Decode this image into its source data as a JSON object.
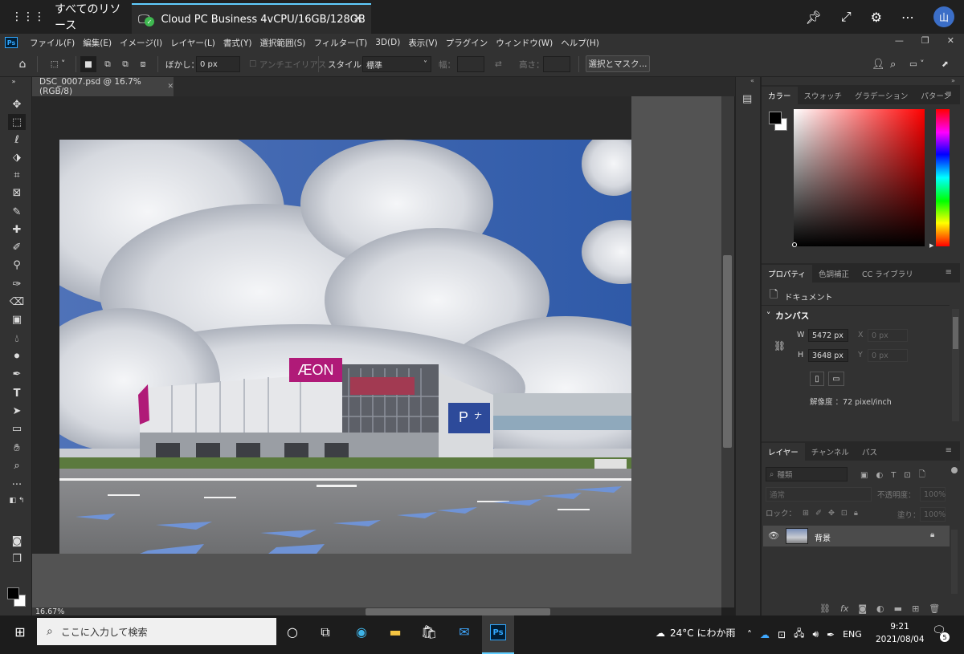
{
  "cloud": {
    "resources_label": "すべてのリソース",
    "tab_title": "Cloud PC Business 4vCPU/16GB/128GB",
    "avatar": "山",
    "check_color": "#3fb950",
    "accent": "#60cdff"
  },
  "menu": [
    "ファイル(F)",
    "編集(E)",
    "イメージ(I)",
    "レイヤー(L)",
    "書式(Y)",
    "選択範囲(S)",
    "フィルター(T)",
    "3D(D)",
    "表示(V)",
    "プラグイン",
    "ウィンドウ(W)",
    "ヘルプ(H)"
  ],
  "ps_logo": "Ps",
  "options": {
    "blur_label": "ぼかし：",
    "blur_value": "0 px",
    "antialias_label": "アンチエイリアス",
    "style_label": "スタイル：",
    "style_value": "標準",
    "width_label": "幅：",
    "height_label": "高さ：",
    "mask_button": "選択とマスク..."
  },
  "document": {
    "tab_title": "DSC_0007.psd @ 16.7% (RGB/8)",
    "zoom": "16.67%",
    "photo_sign": "ÆON",
    "photo_sign2": "P",
    "photo_sign3": "ナ"
  },
  "color_panel": {
    "tabs": [
      "カラー",
      "スウォッチ",
      "グラデーション",
      "パターン"
    ],
    "foreground": "#000000",
    "background": "#ffffff"
  },
  "properties": {
    "tabs": [
      "プロパティ",
      "色調補正",
      "CC ライブラリ"
    ],
    "section": "ドキュメント",
    "canvas_heading": "カンバス",
    "w_label": "W",
    "w_value": "5472 px",
    "h_label": "H",
    "h_value": "3648 px",
    "x_label": "X",
    "x_value": "0 px",
    "y_label": "Y",
    "y_value": "0 px",
    "resolution": "解像度 ：72 pixel/inch"
  },
  "layers": {
    "tabs": [
      "レイヤー",
      "チャンネル",
      "パス"
    ],
    "search_placeholder": "種類",
    "blend_mode": "通常",
    "opacity_label": "不透明度：",
    "opacity_value": "100%",
    "lock_label": "ロック：",
    "fill_label": "塗り：",
    "fill_value": "100%",
    "layer_name": "背景"
  },
  "taskbar": {
    "search_placeholder": "ここに入力して検索",
    "weather": "24°C にわか雨",
    "lang": "ENG",
    "time": "9:21",
    "date": "2021/08/04",
    "notif_count": "5"
  }
}
